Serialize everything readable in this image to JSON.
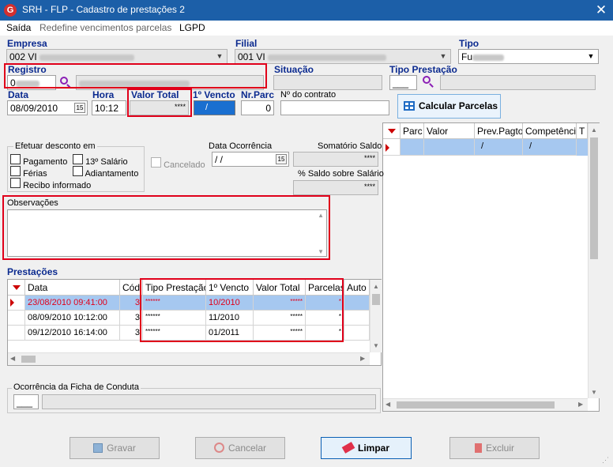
{
  "window": {
    "title": "SRH - FLP - Cadastro de prestações 2",
    "close": "✕"
  },
  "menu": [
    "Saída",
    "Redefine vencimentos parcelas",
    "LGPD"
  ],
  "labels": {
    "empresa": "Empresa",
    "filial": "Filial",
    "tipo": "Tipo",
    "registro": "Registro",
    "situacao": "Situação",
    "tipo_prestacao": "Tipo Prestação",
    "data": "Data",
    "hora": "Hora",
    "valor_total": "Valor Total",
    "primeiro_vencto": "1º Vencto",
    "nr_parc": "Nr.Parc",
    "nr_contrato": "Nº do contrato",
    "efetuar_desconto": "Efetuar desconto em",
    "data_ocorrencia": "Data Ocorrência",
    "somatorio_saldo": "Somatório Saldo",
    "perc_saldo": "% Saldo sobre Salário",
    "observacoes": "Observações",
    "prestacoes": "Prestações",
    "ocorrencia_ficha": "Ocorrência da Ficha de Conduta",
    "cancelado": "Cancelado"
  },
  "fields": {
    "empresa": "002 VI",
    "filial": "001 VI",
    "tipo": "Fu",
    "registro": "0",
    "data": "08/09/2010",
    "hora": "10:12",
    "valor_total": "****",
    "primeiro_vencto": "/",
    "nr_parc": "0",
    "data_ocorrencia": " / /",
    "somatorio_saldo": "****",
    "perc_saldo": "****",
    "calendar_icon": "15"
  },
  "checkboxes": {
    "pagamento": "Pagamento",
    "decimo_terceiro": "13º Salário",
    "ferias": "Férias",
    "adiantamento": "Adiantamento",
    "recibo": "Recibo informado"
  },
  "buttons": {
    "calcular": "Calcular Parcelas",
    "gravar": "Gravar",
    "cancelar": "Cancelar",
    "limpar": "Limpar",
    "excluir": "Excluir"
  },
  "parcelas_grid": {
    "headers": [
      "Parc",
      "Valor",
      "Prev.Pagto",
      "Competência",
      "T"
    ],
    "row": [
      "",
      "",
      "/",
      "/",
      ""
    ]
  },
  "prestacoes_grid": {
    "headers": [
      "Data",
      "Cód",
      "Tipo Prestação",
      "1º Vencto",
      "Valor Total",
      "Parcelas",
      "Auto d"
    ],
    "rows": [
      [
        "23/08/2010 09:41:00",
        "3",
        "******",
        "10/2010",
        "*****",
        "*",
        ""
      ],
      [
        "08/09/2010 10:12:00",
        "3",
        "******",
        "11/2010",
        "*****",
        "*",
        ""
      ],
      [
        "09/12/2010 16:14:00",
        "3",
        "******",
        "01/2011",
        "*****",
        "*",
        ""
      ]
    ]
  },
  "colors": {
    "titlebar": "#1c5fa8",
    "highlight": "#e0001a",
    "selected_row": "#a6c8f0",
    "accent": "#0b2a8f"
  }
}
